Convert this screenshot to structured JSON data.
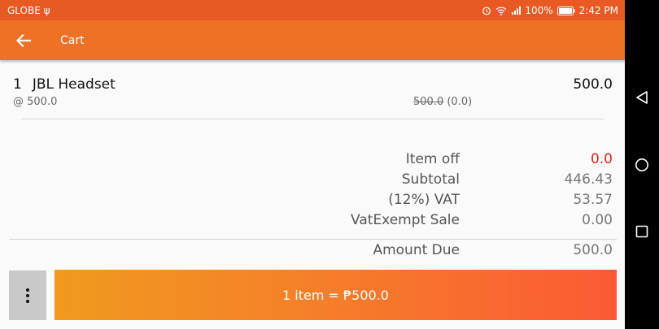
{
  "status_bar": {
    "carrier": "GLOBE",
    "battery": "100%",
    "time": "2:42 PM"
  },
  "app_bar": {
    "title": "Cart"
  },
  "cart": {
    "items": [
      {
        "qty": "1",
        "name": "JBL Headset",
        "total": "500.0",
        "unit_price": "@ 500.0",
        "original": "500.0",
        "discount": "(0.0)"
      }
    ]
  },
  "summary": {
    "item_off_label": "Item off",
    "item_off_value": "0.0",
    "subtotal_label": "Subtotal",
    "subtotal_value": "446.43",
    "vat_label": "(12%) VAT",
    "vat_value": "53.57",
    "vat_exempt_label": "VatExempt Sale",
    "vat_exempt_value": "0.00",
    "amount_due_label": "Amount Due",
    "amount_due_value": "500.0"
  },
  "checkout": {
    "label": "1 item = ₱500.0"
  },
  "colors": {
    "accent": "#ef7126",
    "status_bar": "#e85a24",
    "discount_red": "#e0251b"
  }
}
